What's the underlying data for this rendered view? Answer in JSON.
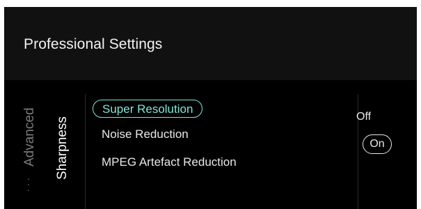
{
  "header": {
    "title": "Professional Settings"
  },
  "breadcrumb": {
    "parent": "Advanced",
    "current": "Sharpness"
  },
  "menu": {
    "items": [
      {
        "label": "Super Resolution",
        "selected": true
      },
      {
        "label": "Noise Reduction",
        "selected": false
      },
      {
        "label": "MPEG Artefact Reduction",
        "selected": false
      }
    ]
  },
  "options": {
    "off_label": "Off",
    "on_label": "On",
    "selected": "On"
  },
  "colors": {
    "accent": "#7fe8dc",
    "background": "#000000",
    "header_background": "#111111",
    "text": "#e8e8e8"
  },
  "icons": {
    "more": "more-vertical-icon"
  }
}
